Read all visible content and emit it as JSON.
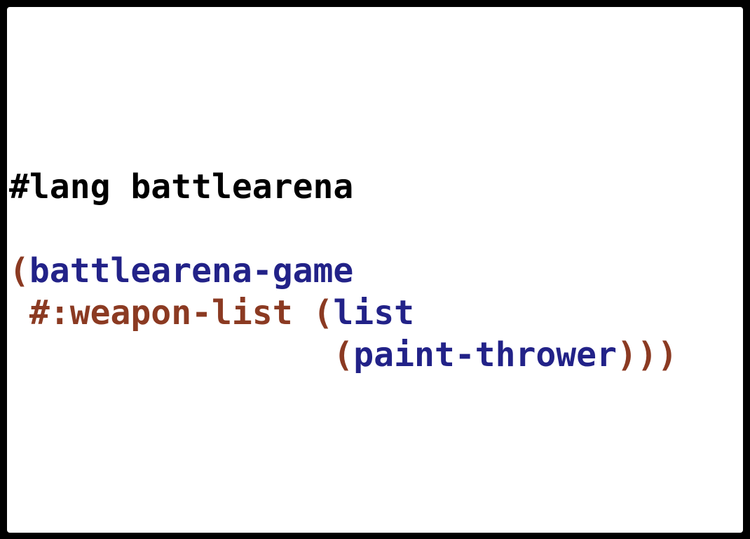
{
  "colors": {
    "background": "#000000",
    "editor": "#ffffff",
    "lang_line": "#000000",
    "identifier": "#222288",
    "punctuation_keyword": "#8b3a22"
  },
  "code": {
    "lang_line": "#lang battlearena",
    "line2": {
      "open": "(",
      "ident": "battlearena-game"
    },
    "line3": {
      "indent": " ",
      "keyword": "#:weapon-list",
      "space": " ",
      "open": "(",
      "ident": "list"
    },
    "line4": {
      "indent": "                ",
      "open": "(",
      "ident": "paint-thrower",
      "close": ")))"
    }
  }
}
